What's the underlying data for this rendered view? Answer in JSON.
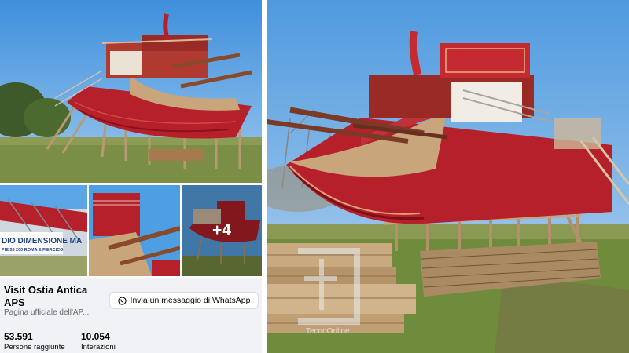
{
  "gallery": {
    "more_count": "+4",
    "banner_line1": "DIO DIMENSIONE MA",
    "banner_line2": "PIE 55 200 ROMA E FIERCICO"
  },
  "page": {
    "name": "Visit Ostia Antica APS",
    "subtitle": "Pagina ufficiale dell'AP..."
  },
  "actions": {
    "whatsapp_label": "Invia un messaggio di WhatsApp"
  },
  "stats": [
    {
      "value": "53.591",
      "label": "Persone raggiunte"
    },
    {
      "value": "10.054",
      "label": "Interazioni"
    }
  ],
  "watermark": {
    "text": "TecnoOnline"
  },
  "colors": {
    "hull_red": "#b5202a",
    "deck_tan": "#c9a57c",
    "sky": "#5aa5e6",
    "grass": "#6f8b3c",
    "panel_bg": "#f0f2f5"
  },
  "icons": {
    "whatsapp": "whatsapp-icon"
  }
}
